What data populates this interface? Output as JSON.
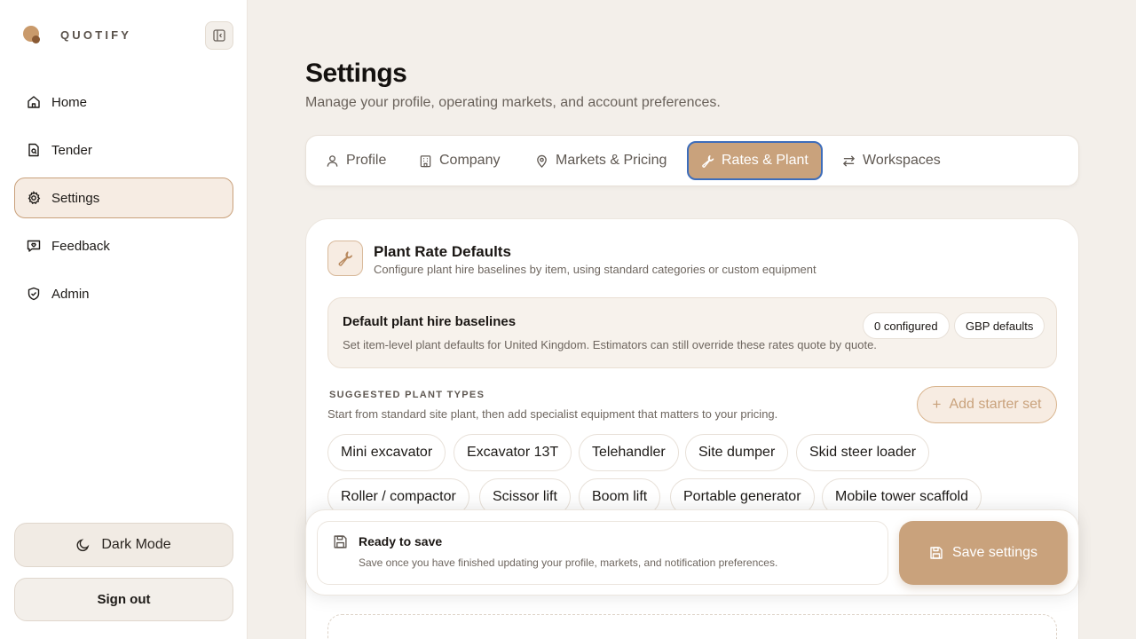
{
  "brand": {
    "name": "QUOTIFY",
    "logo_colors": [
      "#c99a6b",
      "#8a5a34"
    ]
  },
  "sidebar": {
    "collapse_icon": "sidebar-collapse-icon",
    "items": [
      {
        "label": "Home",
        "icon": "home-icon"
      },
      {
        "label": "Tender",
        "icon": "document-icon"
      },
      {
        "label": "Settings",
        "icon": "gear-icon",
        "active": true
      },
      {
        "label": "Feedback",
        "icon": "message-icon"
      },
      {
        "label": "Admin",
        "icon": "shield-icon"
      }
    ],
    "dark_mode_label": "Dark Mode",
    "sign_out_label": "Sign out"
  },
  "page": {
    "title": "Settings",
    "subtitle": "Manage your profile, operating markets, and account preferences."
  },
  "tabs": [
    {
      "label": "Profile",
      "icon": "user-icon"
    },
    {
      "label": "Company",
      "icon": "building-icon"
    },
    {
      "label": "Markets & Pricing",
      "icon": "map-pin-icon"
    },
    {
      "label": "Rates & Plant",
      "icon": "wrench-icon",
      "active": true
    },
    {
      "label": "Workspaces",
      "icon": "swap-icon"
    }
  ],
  "plant": {
    "title": "Plant Rate Defaults",
    "subtitle": "Configure plant hire baselines by item, using standard categories or custom equipment",
    "baseline": {
      "title": "Default plant hire baselines",
      "description": "Set item-level plant defaults for United Kingdom. Estimators can still override these rates quote by quote.",
      "configured_badge": "0 configured",
      "currency_badge": "GBP defaults"
    },
    "suggested": {
      "label": "SUGGESTED PLANT TYPES",
      "description": "Start from standard site plant, then add specialist equipment that matters to your pricing.",
      "add_starter_label": "Add starter set",
      "chips": [
        "Mini excavator",
        "Excavator 13T",
        "Telehandler",
        "Site dumper",
        "Skid steer loader",
        "Roller / compactor",
        "Scissor lift",
        "Boom lift",
        "Portable generator",
        "Mobile tower scaffold"
      ]
    }
  },
  "save_bar": {
    "title": "Ready to save",
    "description": "Save once you have finished updating your profile, markets, and notification preferences.",
    "button_label": "Save settings"
  },
  "colors": {
    "accent": "#c9a27c",
    "focus_ring": "#3d6dbb",
    "background": "#f3efea"
  }
}
